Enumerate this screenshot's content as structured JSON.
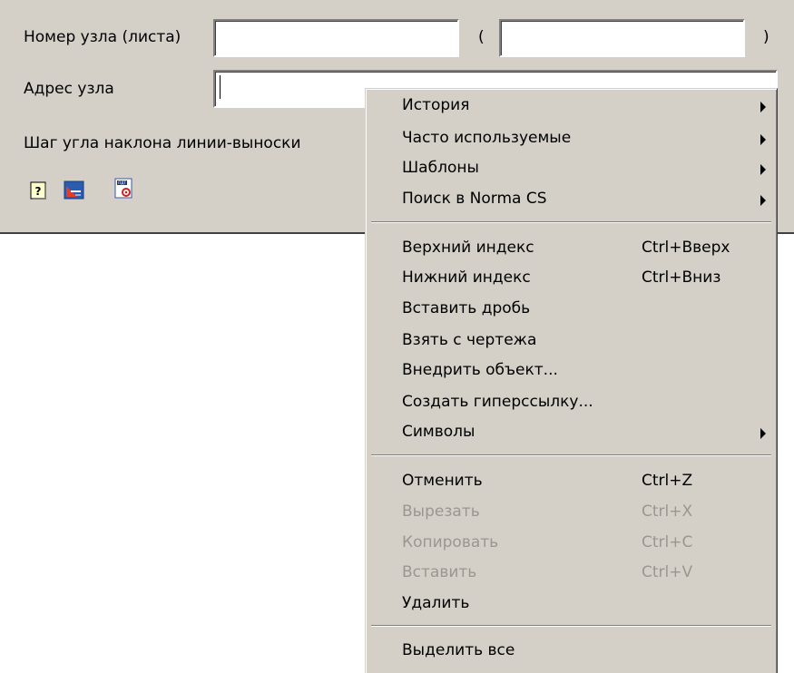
{
  "dialog": {
    "node_number_label": "Номер узла (листа)",
    "node_number_value": "",
    "open_paren": "(",
    "close_paren": ")",
    "sheet_value": "",
    "address_label": "Адрес узла",
    "address_value": "",
    "leader_angle_step_label": "Шаг угла наклона линии-выноски",
    "icons": [
      "help-icon",
      "drawing-icon",
      "settings-sheet-icon"
    ]
  },
  "context_menu": {
    "group1": [
      {
        "label": "История",
        "submenu": true
      },
      {
        "label": "Часто используемые",
        "submenu": true
      },
      {
        "label": "Шаблоны",
        "submenu": true
      },
      {
        "label": "Поиск в Norma CS",
        "submenu": true
      }
    ],
    "group2": [
      {
        "label": "Верхний индекс",
        "shortcut": "Ctrl+Вверх"
      },
      {
        "label": "Нижний индекс",
        "shortcut": "Ctrl+Вниз"
      },
      {
        "label": "Вставить дробь",
        "shortcut": ""
      },
      {
        "label": "Взять с чертежа",
        "shortcut": ""
      },
      {
        "label": "Внедрить объект...",
        "shortcut": ""
      },
      {
        "label": "Создать гиперссылку...",
        "shortcut": ""
      },
      {
        "label": "Символы",
        "submenu": true
      }
    ],
    "group3": [
      {
        "label": "Отменить",
        "shortcut": "Ctrl+Z",
        "enabled": true
      },
      {
        "label": "Вырезать",
        "shortcut": "Ctrl+X",
        "enabled": false
      },
      {
        "label": "Копировать",
        "shortcut": "Ctrl+C",
        "enabled": false
      },
      {
        "label": "Вставить",
        "shortcut": "Ctrl+V",
        "enabled": false
      },
      {
        "label": "Удалить",
        "shortcut": "",
        "enabled": true
      }
    ],
    "group4": [
      {
        "label": "Выделить все",
        "shortcut": ""
      }
    ]
  },
  "colors": {
    "face": "#d4d0c8",
    "disabled_text": "#9a9790"
  }
}
